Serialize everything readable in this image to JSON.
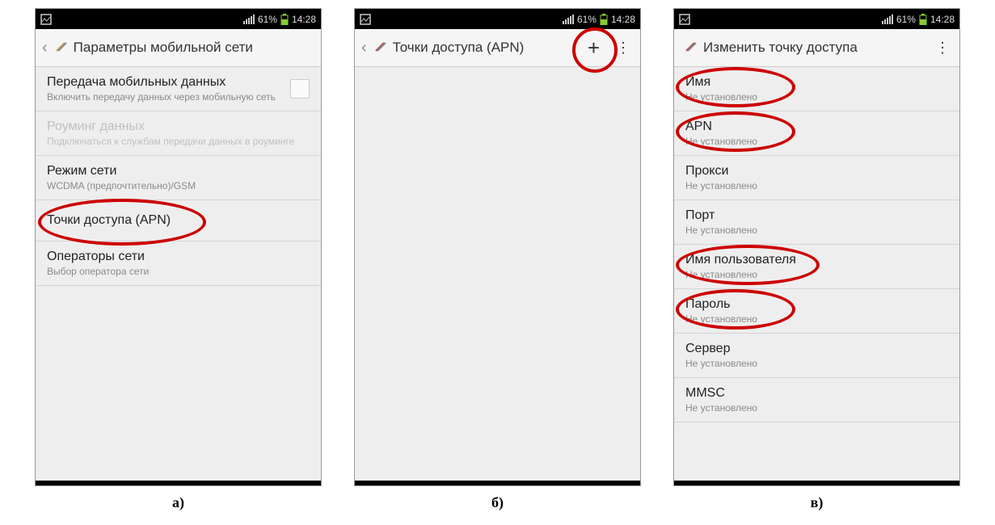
{
  "status": {
    "battery_pct": "61%",
    "time": "14:28"
  },
  "captions": {
    "a": "а)",
    "b": "б)",
    "v": "в)"
  },
  "screen_a": {
    "header_title": "Параметры мобильной сети",
    "rows": [
      {
        "label": "Передача мобильных данных",
        "sub": "Включить передачу данных через мобильную сеть",
        "checkbox": true
      },
      {
        "label": "Роуминг данных",
        "sub": "Подключаться к службам передачи данных в роуминге",
        "disabled": true
      },
      {
        "label": "Режим сети",
        "sub": "WCDMA (предпочтительно)/GSM"
      },
      {
        "label": "Точки доступа (APN)",
        "highlighted": true
      },
      {
        "label": "Операторы сети",
        "sub": "Выбор оператора сети"
      }
    ]
  },
  "screen_b": {
    "header_title": "Точки доступа (APN)",
    "has_plus": true
  },
  "screen_v": {
    "header_title": "Изменить точку доступа",
    "rows": [
      {
        "label": "Имя",
        "sub": "Не установлено",
        "highlighted": true
      },
      {
        "label": "APN",
        "sub": "Не установлено",
        "highlighted": true
      },
      {
        "label": "Прокси",
        "sub": "Не установлено"
      },
      {
        "label": "Порт",
        "sub": "Не установлено"
      },
      {
        "label": "Имя пользователя",
        "sub": "Не установлено",
        "highlighted": true
      },
      {
        "label": "Пароль",
        "sub": "Не установлено",
        "highlighted": true
      },
      {
        "label": "Сервер",
        "sub": "Не установлено"
      },
      {
        "label": "MMSC",
        "sub": "Не установлено"
      }
    ]
  }
}
